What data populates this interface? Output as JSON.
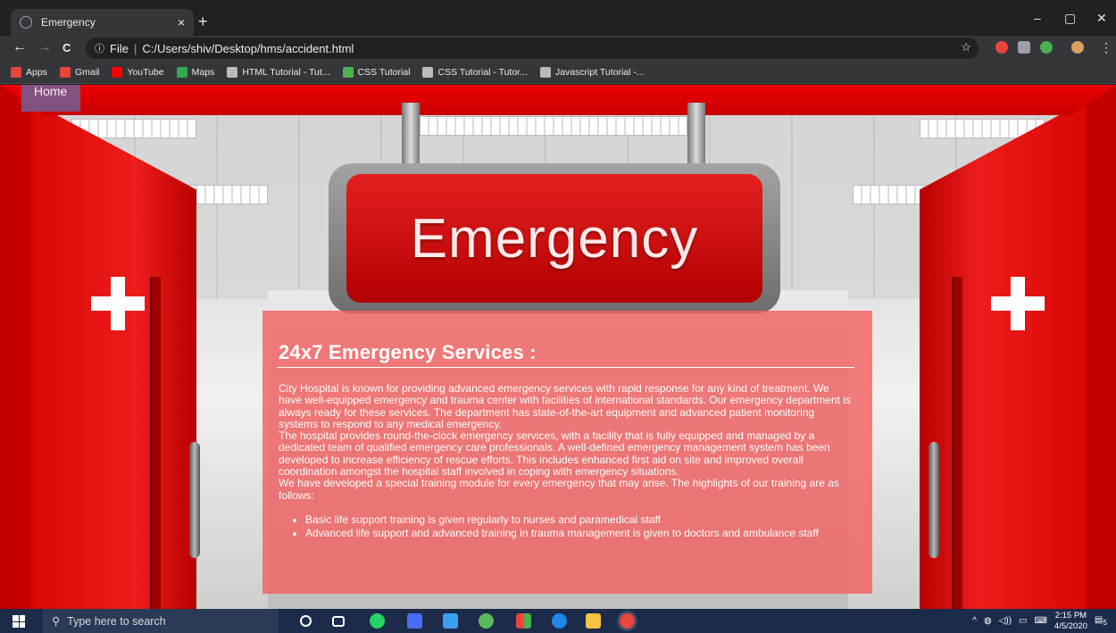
{
  "browser": {
    "tab_title": "Emergency",
    "tab_close": "×",
    "new_tab": "+",
    "window_controls": [
      "–",
      "▢",
      "✕"
    ],
    "nav": {
      "back": "←",
      "forward": "→",
      "reload": "C"
    },
    "address": {
      "scheme": "File",
      "path": "C:/Users/shiv/Desktop/hms/accident.html"
    },
    "bookmarks": [
      {
        "label": "Apps",
        "color": "#e8453c"
      },
      {
        "label": "Gmail",
        "color": "#e8453c"
      },
      {
        "label": "YouTube",
        "color": "#ff0000"
      },
      {
        "label": "Maps",
        "color": "#34a853"
      },
      {
        "label": "HTML Tutorial - Tut...",
        "color": "#bbbbbb"
      },
      {
        "label": "CSS Tutorial",
        "color": "#4caf50"
      },
      {
        "label": "CSS Tutorial - Tutor...",
        "color": "#bbbbbb"
      },
      {
        "label": "Javascript Tutorial -...",
        "color": "#bbbbbb"
      }
    ]
  },
  "page": {
    "home_label": "Home",
    "sign_text": "Emergency",
    "heading": "24x7 Emergency Services :",
    "paragraphs": [
      "City Hospital is known for providing advanced emergency services with rapid response for any kind of treatment. We have well-equipped emergency and trauma center with facilities of international standards. Our emergency department is always ready for these services. The department has state-of-the-art equipment and advanced patient monitoring systems to respond to any medical emergency.",
      "The hospital provides round-the-clock emergency services, with a facility that is fully equipped and managed by a dedicated team of qualified emergency care professionals. A well-defined emergency management system has been developed to increase efficiency of rescue efforts. This includes enhanced first aid on site and improved overall coordination amongst the hospital staff involved in coping with emergency situations.",
      "We have developed a special training module for every emergency that may arise. The highlights of our training are as follows:"
    ],
    "bullets": [
      "Basic life support training is given regularly to nurses and paramedical staff",
      "Advanced life support and advanced training in trauma management is given to doctors and ambulance staff"
    ]
  },
  "taskbar": {
    "search_placeholder": "Type here to search",
    "time": "2:15 PM",
    "date": "4/5/2020",
    "notifications": "5"
  }
}
